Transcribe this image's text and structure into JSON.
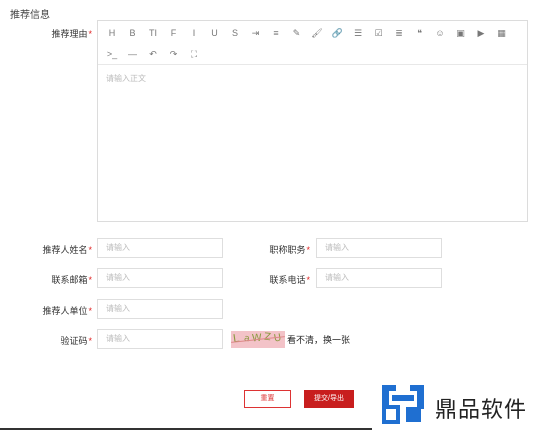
{
  "section_title": "推荐信息",
  "editor": {
    "label": "推荐理由",
    "required_mark": "*",
    "placeholder": "请输入正文",
    "toolbar_row1": [
      {
        "name": "heading-icon",
        "glyph": "H"
      },
      {
        "name": "bold-icon",
        "glyph": "B"
      },
      {
        "name": "font-size-icon",
        "glyph": "TI"
      },
      {
        "name": "font-family-icon",
        "glyph": "F"
      },
      {
        "name": "italic-icon",
        "glyph": "I"
      },
      {
        "name": "underline-icon",
        "glyph": "U"
      },
      {
        "name": "strikethrough-icon",
        "glyph": "S"
      },
      {
        "name": "indent-icon",
        "glyph": "⇥"
      },
      {
        "name": "line-height-icon",
        "glyph": "≡"
      },
      {
        "name": "font-color-icon",
        "glyph": "✎"
      },
      {
        "name": "bg-color-icon",
        "glyph": "🖌"
      },
      {
        "name": "link-icon",
        "glyph": "🔗"
      },
      {
        "name": "bullet-list-icon",
        "glyph": "☰"
      },
      {
        "name": "checkbox-list-icon",
        "glyph": "☑"
      },
      {
        "name": "align-icon",
        "glyph": "≣"
      },
      {
        "name": "quote-icon",
        "glyph": "❝"
      },
      {
        "name": "emoji-icon",
        "glyph": "☺"
      },
      {
        "name": "image-icon",
        "glyph": "▣"
      },
      {
        "name": "video-icon",
        "glyph": "▶"
      },
      {
        "name": "table-icon",
        "glyph": "▦"
      }
    ],
    "toolbar_row2": [
      {
        "name": "code-icon",
        "glyph": ">_"
      },
      {
        "name": "divider-icon",
        "glyph": "—"
      },
      {
        "name": "undo-icon",
        "glyph": "↶"
      },
      {
        "name": "redo-icon",
        "glyph": "↷"
      },
      {
        "name": "fullscreen-icon",
        "glyph": "⛶"
      }
    ]
  },
  "fields": {
    "recommender_name": {
      "label": "推荐人姓名",
      "placeholder": "请输入"
    },
    "job_title": {
      "label": "职称职务",
      "placeholder": "请输入"
    },
    "email": {
      "label": "联系邮箱",
      "placeholder": "请输入"
    },
    "phone": {
      "label": "联系电话",
      "placeholder": "请输入"
    },
    "organization": {
      "label": "推荐人单位",
      "placeholder": "请输入"
    },
    "captcha": {
      "label": "验证码",
      "placeholder": "请输入"
    }
  },
  "required_mark": "*",
  "captcha": {
    "chars": [
      "L",
      "a",
      "W",
      "Z",
      "U"
    ],
    "refresh_text": "看不清，换一张"
  },
  "buttons": {
    "reset": "重置",
    "submit": "提交/导出"
  },
  "watermark": {
    "text": "鼎品软件",
    "color": "#1f6fd1"
  }
}
